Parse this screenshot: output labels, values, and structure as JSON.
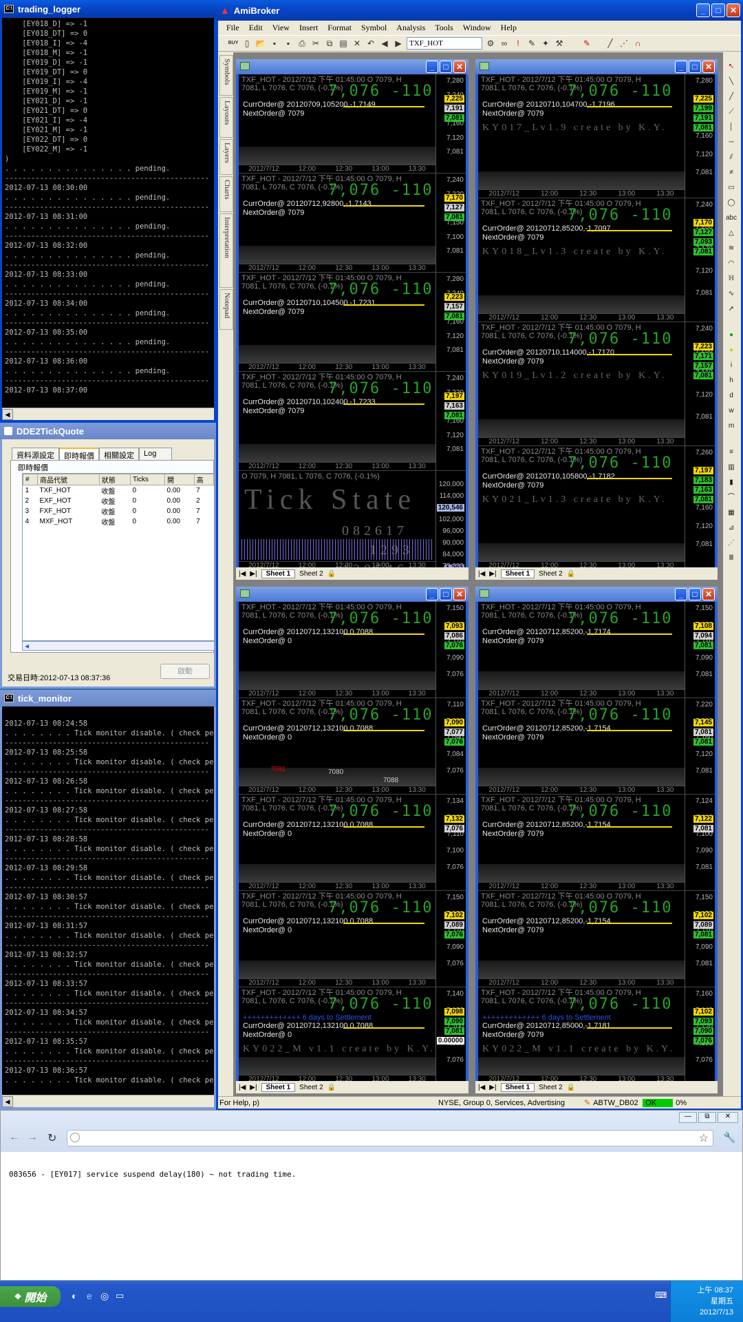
{
  "trading_logger": {
    "title": "trading_logger",
    "lines": [
      "    [EY018_D] => -1",
      "    [EY018_DT] => 0",
      "    [EY018_I] => -4",
      "    [EY018_M] => -1",
      "    [EY019_D] => -1",
      "    [EY019_DT] => 0",
      "    [EY019_I] => -4",
      "    [EY019_M] => -1",
      "    [EY021_D] => -1",
      "    [EY021_DT] => 0",
      "    [EY021_I] => -4",
      "    [EY021_M] => -1",
      "    [EY022_DT] => 0",
      "    [EY022_M] => -1",
      ")",
      "",
      ". . . . . . . . . . . . . . . pending.",
      "-----------------------------------------------",
      "2012-07-13 08:30:00",
      "",
      ". . . . . . . . . . . . . . . pending.",
      "-----------------------------------------------",
      "2012-07-13 08:31:00",
      "",
      ". . . . . . . . . . . . . . . pending.",
      "-----------------------------------------------",
      "2012-07-13 08:32:00",
      "",
      ". . . . . . . . . . . . . . . pending.",
      "-----------------------------------------------",
      "2012-07-13 08:33:00",
      "",
      ". . . . . . . . . . . . . . . pending.",
      "-----------------------------------------------",
      "2012-07-13 08:34:00",
      "",
      ". . . . . . . . . . . . . . . pending.",
      "-----------------------------------------------",
      "2012-07-13 08:35:00",
      "",
      ". . . . . . . . . . . . . . . pending.",
      "-----------------------------------------------",
      "2012-07-13 08:36:00",
      "",
      ". . . . . . . . . . . . . . . pending.",
      "-----------------------------------------------",
      "2012-07-13 08:37:00"
    ]
  },
  "dde": {
    "title": "DDE2TickQuote",
    "tabs": [
      "資料源設定",
      "即時報價",
      "相關設定",
      "Log"
    ],
    "group_label": "即時報價",
    "columns": [
      "#",
      "商品代號",
      "狀態",
      "Ticks",
      "開",
      "高"
    ],
    "rows": [
      [
        "1",
        "TXF_HOT",
        "收盤",
        "0",
        "0.00",
        "7"
      ],
      [
        "2",
        "EXF_HOT",
        "收盤",
        "0",
        "0.00",
        "2"
      ],
      [
        "3",
        "FXF_HOT",
        "收盤",
        "0",
        "0.00",
        "7"
      ],
      [
        "4",
        "MXF_HOT",
        "收盤",
        "0",
        "0.00",
        "7"
      ]
    ],
    "trade_time": "交易日時:2012-07-13 08:37:36",
    "button": "啟動"
  },
  "tick_monitor": {
    "title": "tick_monitor",
    "lines": [
      "2012-07-13 08:24:58",
      ". . . . . . . . Tick monitor disable. ( check per 60",
      "-----------------------------------------------",
      "2012-07-13 08:25:58",
      ". . . . . . . . Tick monitor disable. ( check per 60",
      "-----------------------------------------------",
      "2012-07-13 08:26:58",
      ". . . . . . . . Tick monitor disable. ( check per 60",
      "-----------------------------------------------",
      "2012-07-13 08:27:58",
      ". . . . . . . . Tick monitor disable. ( check per 60",
      "-----------------------------------------------",
      "2012-07-13 08:28:58",
      ". . . . . . . . Tick monitor disable. ( check per 60",
      "-----------------------------------------------",
      "2012-07-13 08:29:58",
      ". . . . . . . . Tick monitor disable. ( check per 60",
      "-----------------------------------------------",
      "2012-07-13 08:30:57",
      ". . . . . . . . Tick monitor disable. ( check per 60",
      "-----------------------------------------------",
      "2012-07-13 08:31:57",
      ". . . . . . . . Tick monitor disable. ( check per 60",
      "-----------------------------------------------",
      "2012-07-13 08:32:57",
      ". . . . . . . . Tick monitor disable. ( check per 60",
      "-----------------------------------------------",
      "2012-07-13 08:33:57",
      ". . . . . . . . Tick monitor disable. ( check per 60",
      "-----------------------------------------------",
      "2012-07-13 08:34:57",
      ". . . . . . . . Tick monitor disable. ( check per 60",
      "-----------------------------------------------",
      "2012-07-13 08:35:57",
      ". . . . . . . . Tick monitor disable. ( check per 60",
      "-----------------------------------------------",
      "2012-07-13 08:36:57",
      ". . . . . . . . Tick monitor disable. ( check per 60"
    ]
  },
  "amibroker": {
    "title": "AmiBroker",
    "menu": [
      "File",
      "Edit",
      "View",
      "Insert",
      "Format",
      "Symbol",
      "Analysis",
      "Tools",
      "Window",
      "Help"
    ],
    "symbol": "TXF_HOT",
    "side_tabs": [
      "Symbols",
      "Layouts",
      "Layers",
      "Charts",
      "Interpretation",
      "Notepad"
    ],
    "status_help": "For Help, p)",
    "status_market": "NYSE, Group 0, Services, Advertising",
    "status_db": "ABTW_DB02",
    "status_ok": "OK",
    "status_pct": "0%",
    "sheet1": "Sheet 1",
    "sheet2": "Sheet 2",
    "header_line1": "TXF_HOT - 2012/7/12 下午 01:45:00  O 7079,  H",
    "header_line2": "7081,  L 7076,  C 7076,  (-0.1%)",
    "big_value": "7,076  -110",
    "date_label": "2012/7/12",
    "times": [
      "12:00",
      "12:30",
      "13:00",
      "13:30"
    ],
    "tick_state": {
      "header": "O 7079,  H 7081,  L 7076,  C 7076,  (-0.1%)",
      "title": "Tick State",
      "n1": "082617",
      "n2": "1293",
      "n3": "120546",
      "axis": [
        "120,000",
        "114,000",
        "108,000",
        "102,000",
        "96,000",
        "90,000",
        "84,000",
        "78,000"
      ],
      "tag1": "120,546",
      "tag2": "1,293",
      "tag3": "0.00000"
    },
    "win1": [
      {
        "order": "CurrOrder@ 20120709,105200,-1,7149",
        "next": "NextOrder@ 7079",
        "axis": [
          "7,280",
          "7,240",
          "7,200",
          "7,160",
          "7,120",
          "7,081"
        ],
        "t1": "7,225",
        "t2": "7,191",
        "t3": "7,081"
      },
      {
        "order": "CurrOrder@ 20120712,92800,-1,7143",
        "next": "NextOrder@ 7079",
        "axis": [
          "7,240",
          "7,220",
          "7,200",
          "7,150",
          "7,100",
          "7,081"
        ],
        "t1": "7,170",
        "t2": "7,127",
        "t3": "7,081"
      },
      {
        "order": "CurrOrder@ 20120710,104500,-1,7231",
        "next": "NextOrder@ 7079",
        "axis": [
          "7,280",
          "7,240",
          "7,200",
          "7,160",
          "7,120",
          "7,081"
        ],
        "t1": "7,223",
        "t2": "7,157",
        "t3": "7,081"
      },
      {
        "order": "CurrOrder@ 20120710,102400,-1,7233",
        "next": "NextOrder@ 7079",
        "axis": [
          "7,240",
          "7,220",
          "7,200",
          "7,160",
          "7,120",
          "7,081"
        ],
        "t1": "7,197",
        "t2": "7,163",
        "t3": "7,081"
      }
    ],
    "win2": [
      {
        "order": "CurrOrder@ 20120710,104700,-1,7196",
        "next": "NextOrder@ 7079",
        "wm": "KY017_Lv1.9  create by K.Y.",
        "axis": [
          "7,280",
          "7,240",
          "7,200",
          "7,160",
          "7,120",
          "7,081"
        ],
        "t1": "7,225",
        "t2": "7,199",
        "t3": "7,191",
        "t4": "7,081"
      },
      {
        "order": "CurrOrder@ 20120712,85200,-1,7097",
        "next": "NextOrder@ 7079",
        "wm": "KY018_Lv1.3  create by K.Y.",
        "axis": [
          "7,240",
          "7,200",
          "7,170",
          "7,120",
          "7,081"
        ],
        "t1": "7,170",
        "t2": "7,127",
        "t3": "7,093",
        "t4": "7,081"
      },
      {
        "order": "CurrOrder@ 20120710,114000,-1,7170",
        "next": "NextOrder@ 7079",
        "wm": "KY019_Lv1.2  create by K.Y.",
        "axis": [
          "7,240",
          "7,200",
          "7,160",
          "7,120",
          "7,081"
        ],
        "t1": "7,223",
        "t2": "7,171",
        "t3": "7,157",
        "t4": "7,081"
      },
      {
        "order": "CurrOrder@ 20120710,105800,-1,7182",
        "next": "NextOrder@ 7079",
        "wm": "KY021_Lv1.3  create by K.Y.",
        "axis": [
          "7,260",
          "7,240",
          "7,200",
          "7,160",
          "7,120",
          "7,081"
        ],
        "t1": "7,197",
        "t2": "7,183",
        "t3": "7,163",
        "t4": "7,081"
      }
    ],
    "win3": [
      {
        "order": "CurrOrder@ 20120712,132100,0,7088",
        "next": "NextOrder@ 0",
        "axis": [
          "7,150",
          "7,130",
          "7,110",
          "7,090",
          "7,076"
        ],
        "t1": "7,093",
        "t2": "7,086",
        "t3": "7,076"
      },
      {
        "order": "CurrOrder@ 20120712,132100,0,7088",
        "next": "NextOrder@ 0",
        "axis": [
          "7,110",
          "7,098",
          "7,090",
          "7,084",
          "7,076"
        ],
        "t1": "7,090",
        "t2": "7,077",
        "t3": "7,076",
        "m1": "7091",
        "m2": "7080",
        "m3": "7088"
      },
      {
        "order": "CurrOrder@ 20120712,132100,0,7088",
        "next": "NextOrder@ 0",
        "axis": [
          "7,134",
          "7,120",
          "7,110",
          "7,100",
          "7,076"
        ],
        "t1": "7,132",
        "t2": "7,076"
      },
      {
        "order": "CurrOrder@ 20120712,132100,0,7088",
        "next": "NextOrder@ 0",
        "axis": [
          "7,150",
          "7,130",
          "7,110",
          "7,090",
          "7,076"
        ],
        "t1": "7,102",
        "t2": "7,089",
        "t3": "7,076"
      },
      {
        "order": "CurrOrder@ 20120712,132100,0,7088",
        "next": "NextOrder@ 0",
        "banner": "+++++++++++++ 6 days to Settlement",
        "wm": "KY022_M  v1.1  create by K.Y.",
        "axis": [
          "7,140",
          "7,120",
          "7,100",
          "7,080",
          "7,076"
        ],
        "t1": "7,098",
        "t2": "7,090",
        "t3": "7,081",
        "t4": "0.00000"
      }
    ],
    "win4": [
      {
        "order": "CurrOrder@ 20120712,85200,-1,7174",
        "next": "NextOrder@ 7079",
        "axis": [
          "7,150",
          "7,130",
          "7,110",
          "7,090",
          "7,081"
        ],
        "t1": "7,108",
        "t2": "7,094",
        "t3": "7,081"
      },
      {
        "order": "CurrOrder@ 20120712,85200,-1,7154",
        "next": "NextOrder@ 7079",
        "axis": [
          "7,220",
          "7,200",
          "7,160",
          "7,120",
          "7,081"
        ],
        "t1": "7,145",
        "t2": "7,081",
        "t3": "7,081"
      },
      {
        "order": "CurrOrder@ 20120712,85200,-1,7154",
        "next": "NextOrder@ 7079",
        "axis": [
          "7,124",
          "7,110",
          "7,100",
          "7,090",
          "7,081"
        ],
        "t1": "7,122",
        "t2": "7,081"
      },
      {
        "order": "CurrOrder@ 20120712,85200,-1,7154",
        "next": "NextOrder@ 7079",
        "axis": [
          "7,150",
          "7,130",
          "7,110",
          "7,090",
          "7,081"
        ],
        "t1": "7,102",
        "t2": "7,089",
        "t3": "7,081"
      },
      {
        "order": "CurrOrder@ 20120712,85000,-1,7181",
        "next": "NextOrder@ 7079",
        "banner": "+++++++++++++ 6 days to Settlement",
        "wm": "KY022_M  v1.1  create by K.Y.",
        "axis": [
          "7,160",
          "7,140",
          "7,120",
          "7,100",
          "7,076"
        ],
        "t1": "7,102",
        "t2": "7,093",
        "t3": "7,090",
        "t4": "7,076"
      }
    ]
  },
  "browser": {
    "url": "",
    "content": "083656 - [EY017] service suspend delay(180) ~ not trading time."
  },
  "taskbar": {
    "start": "開始",
    "time": "上午 08:37",
    "day": "星期五",
    "date": "2012/7/13"
  }
}
